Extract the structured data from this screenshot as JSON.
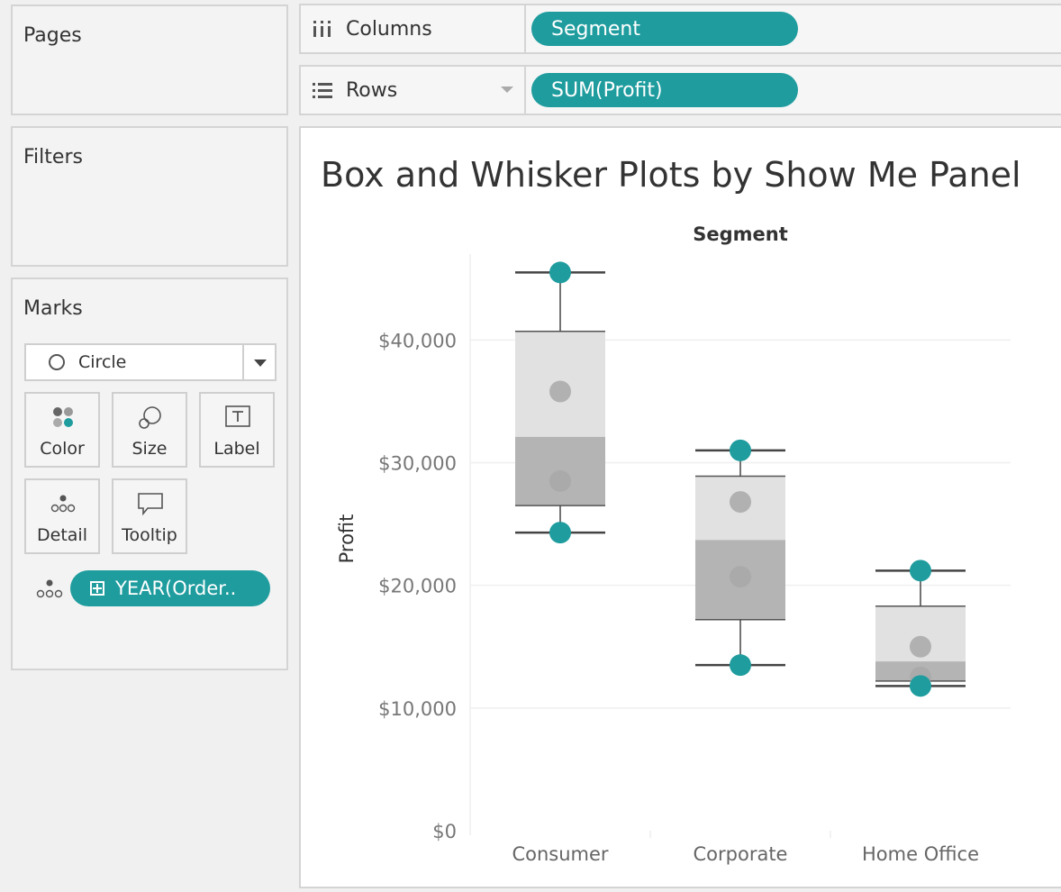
{
  "cards": {
    "pages": {
      "title": "Pages"
    },
    "filters": {
      "title": "Filters"
    },
    "marks": {
      "title": "Marks",
      "mark_type": "Circle",
      "buttons": {
        "color": "Color",
        "size": "Size",
        "label": "Label",
        "detail": "Detail",
        "tooltip": "Tooltip"
      },
      "detail_field": "YEAR(Order.."
    }
  },
  "shelves": {
    "columns": {
      "label": "Columns",
      "pill": "Segment"
    },
    "rows": {
      "label": "Rows",
      "pill": "SUM(Profit)"
    }
  },
  "colors": {
    "accent": "#1f9c9e",
    "box_upper": "#e1e1e1",
    "box_lower": "#b4b4b4",
    "inner_mark": "#a8a8a8"
  },
  "viz": {
    "title": "Box and Whisker Plots by Show Me Panel"
  },
  "chart_data": {
    "type": "box",
    "title": "Box and Whisker Plots by Show Me Panel",
    "column_header": "Segment",
    "ylabel": "Profit",
    "ylim": [
      0,
      47000
    ],
    "y_ticks": [
      0,
      10000,
      20000,
      30000,
      40000
    ],
    "y_tick_labels": [
      "$0",
      "$10,000",
      "$20,000",
      "$30,000",
      "$40,000"
    ],
    "categories": [
      "Consumer",
      "Corporate",
      "Home Office"
    ],
    "boxes": [
      {
        "category": "Consumer",
        "whisker_low": 24300,
        "q1": 26500,
        "median": 32100,
        "q3": 40700,
        "whisker_high": 45500,
        "points": [
          45500,
          35800,
          28500,
          24300
        ]
      },
      {
        "category": "Corporate",
        "whisker_low": 13500,
        "q1": 17200,
        "median": 23700,
        "q3": 28900,
        "whisker_high": 31000,
        "points": [
          31000,
          26800,
          20700,
          13500
        ]
      },
      {
        "category": "Home Office",
        "whisker_low": 11800,
        "q1": 12200,
        "median": 13800,
        "q3": 18300,
        "whisker_high": 21200,
        "points": [
          21200,
          15000,
          12500,
          11800
        ]
      }
    ],
    "grid": true,
    "legend": "none"
  }
}
